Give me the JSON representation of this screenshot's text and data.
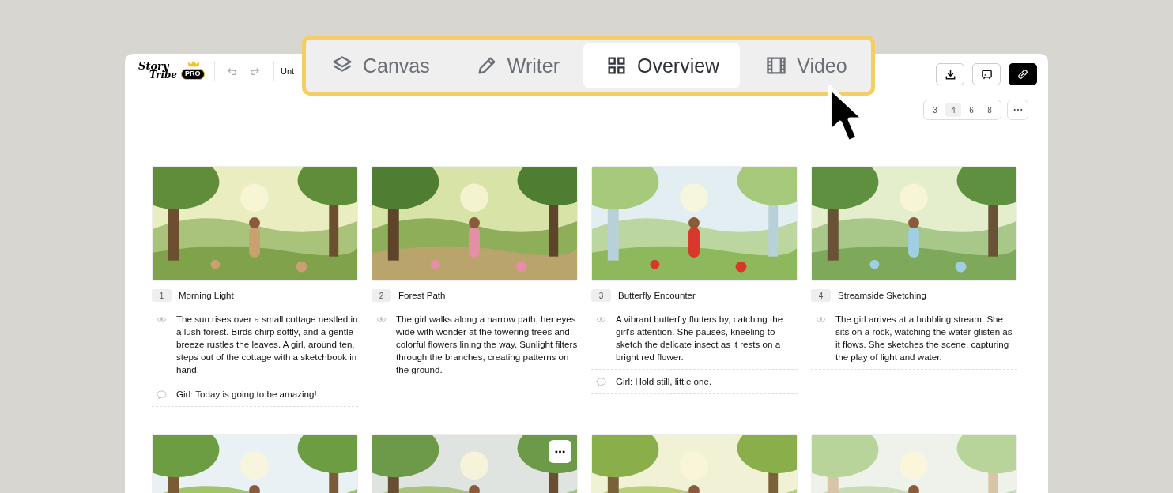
{
  "logo": {
    "line_1": "Story",
    "line_2": "Tribe",
    "badge": "PRO"
  },
  "document": {
    "title": "Unt"
  },
  "tabs": [
    {
      "label": "Canvas",
      "selected": false
    },
    {
      "label": "Writer",
      "selected": false
    },
    {
      "label": "Overview",
      "selected": true
    },
    {
      "label": "Video",
      "selected": false
    }
  ],
  "column_options": [
    {
      "label": "3",
      "selected": false
    },
    {
      "label": "4",
      "selected": true
    },
    {
      "label": "6",
      "selected": false
    },
    {
      "label": "8",
      "selected": false
    }
  ],
  "scenes": [
    {
      "kind": "captioned",
      "number": "1",
      "title": "Morning Light",
      "description": "The sun rises over a small cottage nestled in a lush forest. Birds chirp softly, and a gentle breeze rustles the leaves. A girl, around ten, steps out of the cottage with a sketchbook in hand.",
      "dialogue": "Girl: Today is going to be amazing!"
    },
    {
      "kind": "captioned",
      "number": "2",
      "title": "Forest Path",
      "description": "The girl walks along a narrow path, her eyes wide with wonder at the towering trees and colorful flowers lining the way. Sunlight filters through the branches, creating patterns on the ground."
    },
    {
      "kind": "captioned",
      "number": "3",
      "title": "Butterfly Encounter",
      "description": "A vibrant butterfly flutters by, catching the girl's attention. She pauses, kneeling to sketch the delicate insect as it rests on a bright red flower.",
      "dialogue": "Girl: Hold still, little one."
    },
    {
      "kind": "captioned",
      "number": "4",
      "title": "Streamside Sketching",
      "description": "The girl arrives at a bubbling stream. She sits on a rock, watching the water glisten as it flows. She sketches the scene, capturing the play of light and water."
    },
    {
      "kind": "picture"
    },
    {
      "kind": "picture",
      "menu_button": true
    },
    {
      "kind": "picture"
    },
    {
      "kind": "picture"
    }
  ]
}
